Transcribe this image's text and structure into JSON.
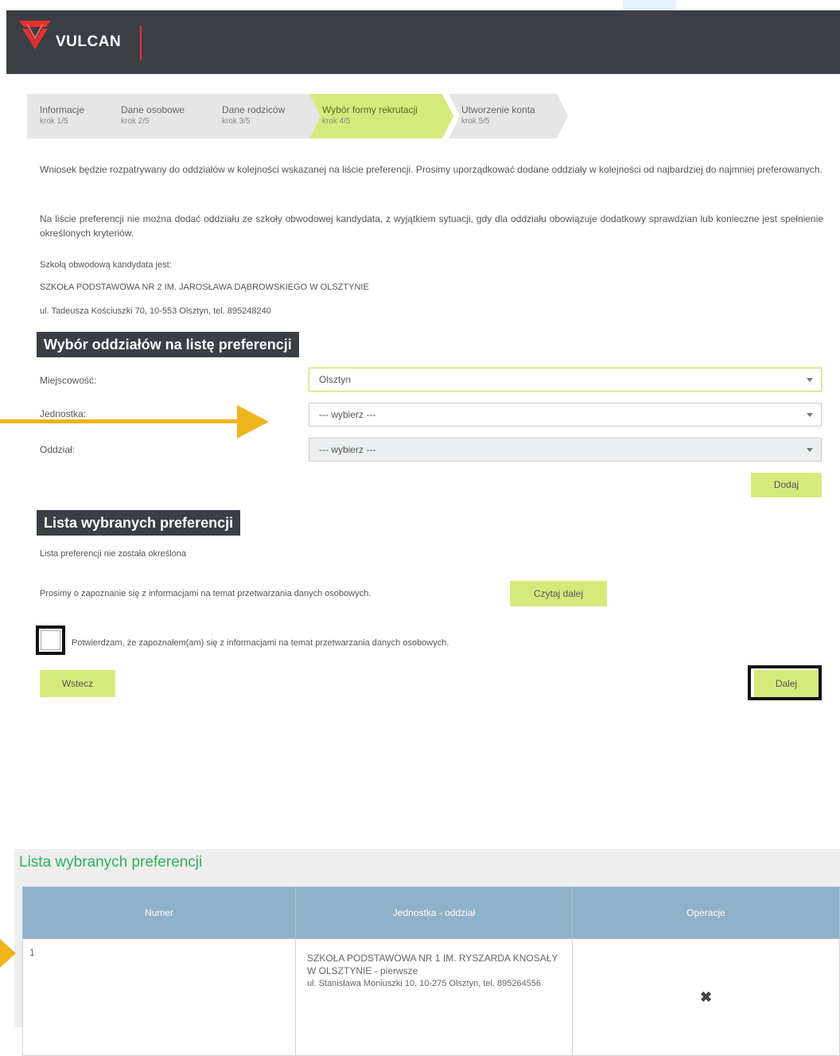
{
  "colors": {
    "accent": "#d6ea7c",
    "header": "#3b3e45",
    "arrow": "#f0b41c",
    "table_header": "#8fb1c9",
    "title_green": "#2fb05a"
  },
  "brand": {
    "name": "VULCAN",
    "logo_icon": "vulcan-v-logo-icon"
  },
  "steps": [
    {
      "title": "Informacje",
      "sub": "krok 1/5"
    },
    {
      "title": "Dane osobowe",
      "sub": "krok 2/5"
    },
    {
      "title": "Dane rodziców",
      "sub": "krok 3/5"
    },
    {
      "title": "Wybór formy rekrutacji",
      "sub": "krok 4/5"
    },
    {
      "title": "Utworzenie konta",
      "sub": "krok 5/5"
    }
  ],
  "info": {
    "p1": "Wniosek będzie rozpatrywany do oddziałów w kolejności wskazanej na liście preferencji. Prosimy uporządkować dodane oddziały w kolejności od najbardziej do najmniej preferowanych.",
    "p2": "Na liście preferencji nie można dodać oddziału ze szkoły obwodowej kandydata, z wyjątkiem sytuacji, gdy dla oddziału obowiązuje dodatkowy sprawdzian lub konieczne jest spełnienie określonych kryteriów.",
    "school_label": "Szkołą obwodową kandydata jest:",
    "school_name": "SZKOŁA PODSTAWOWA NR 2 IM. JAROSŁAWA DĄBROWSKIEGO W OLSZTYNIE",
    "school_address": "ul. Tadeusza Kościuszki 70, 10-553 Olsztyn, tel. 895248240"
  },
  "selection": {
    "heading": "Wybór oddziałów na listę preferencji",
    "city_label": "Miejscowość:",
    "city_value": "Olsztyn",
    "unit_label": "Jednostka:",
    "unit_value": "--- wybierz ---",
    "branch_label": "Oddział:",
    "branch_value": "--- wybierz ---",
    "add_button": "Dodaj"
  },
  "preferences": {
    "heading": "Lista wybranych preferencji",
    "empty_text": "Lista preferencji nie została określona",
    "gdpr_text": "Prosimy o zapoznanie się z informacjami na temat przetwarzania danych osobowych.",
    "read_more": "Czytaj dalej",
    "confirm_text": "Potwierdzam, że zapoznałem(am) się z informacjami na temat przetwarzania danych osobowych."
  },
  "nav": {
    "back": "Wstecz",
    "next": "Dalej"
  },
  "bottom": {
    "title": "Lista wybranych preferencji",
    "columns": [
      "Numer",
      "Jednostka - oddział",
      "Operacje"
    ],
    "rows": [
      {
        "number": "1",
        "unit": "SZKOŁA PODSTAWOWA NR 1 IM. RYSZARDA KNOSAŁY W OLSZTYNIE - pierwsze",
        "address": "ul. Stanisława Moniuszki 10, 10-275 Olsztyn, tel. 895264556",
        "operation_icon": "delete-x-icon"
      }
    ]
  }
}
